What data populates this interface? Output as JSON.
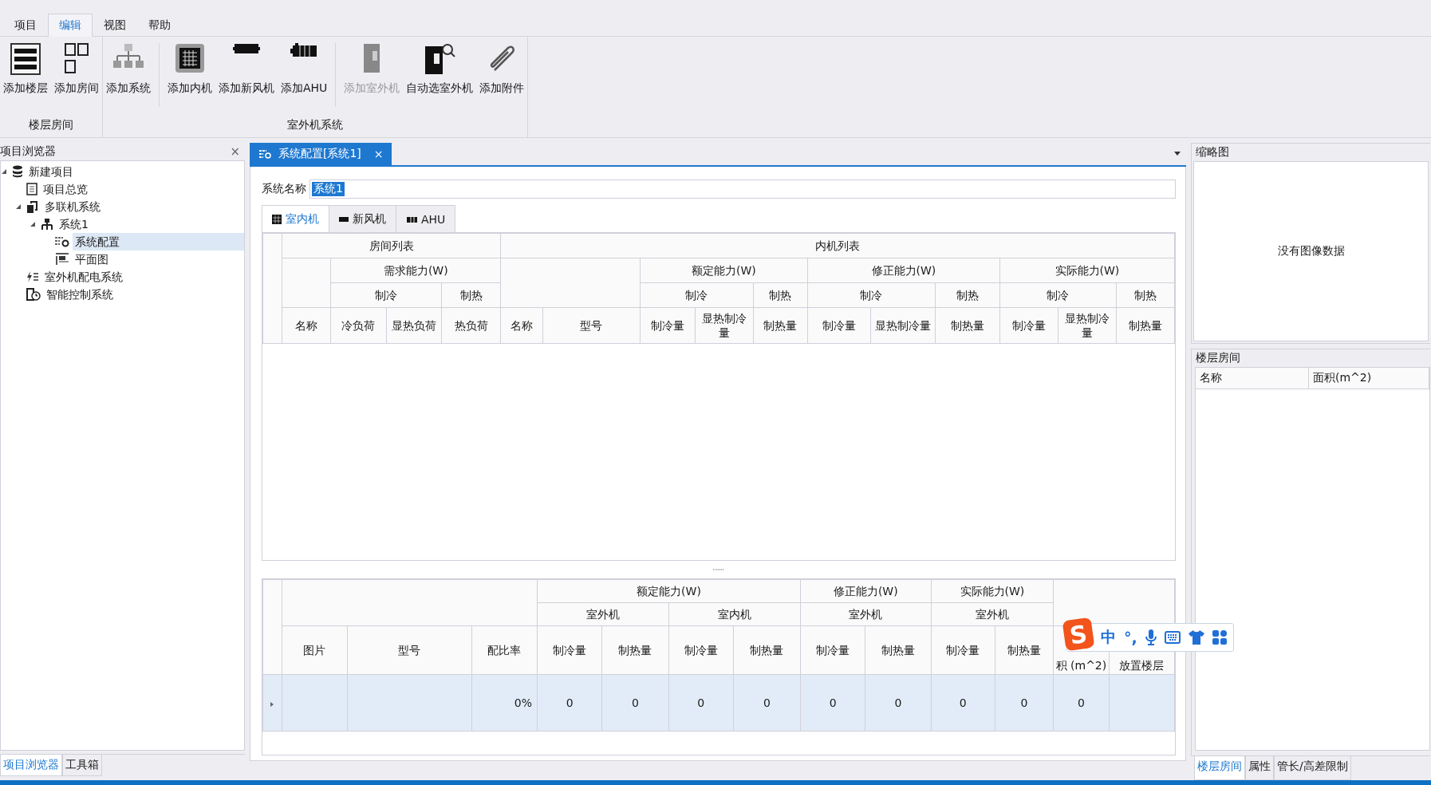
{
  "menu": {
    "tabs": [
      {
        "label": "项目",
        "selected": false
      },
      {
        "label": "编辑",
        "selected": true
      },
      {
        "label": "视图",
        "selected": false
      },
      {
        "label": "帮助",
        "selected": false
      }
    ]
  },
  "ribbon": {
    "groups": [
      {
        "label": "楼层房间",
        "buttons": [
          {
            "label": "添加楼层",
            "disabled": false,
            "divider_before": false
          },
          {
            "label": "添加房间",
            "disabled": false,
            "divider_before": false
          }
        ]
      },
      {
        "label": "室外机系统",
        "buttons": [
          {
            "label": "添加系统",
            "disabled": false,
            "divider_before": false
          },
          {
            "label": "添加内机",
            "disabled": false,
            "divider_before": true
          },
          {
            "label": "添加新风机",
            "disabled": false,
            "divider_before": false
          },
          {
            "label": "添加AHU",
            "disabled": false,
            "divider_before": false
          },
          {
            "label": "添加室外机",
            "disabled": true,
            "divider_before": true
          },
          {
            "label": "自动选室外机",
            "disabled": false,
            "divider_before": false
          },
          {
            "label": "添加附件",
            "disabled": false,
            "divider_before": false
          }
        ]
      }
    ]
  },
  "project_browser": {
    "title": "项目浏览器",
    "close": "×",
    "tree": [
      {
        "label": "新建项目",
        "expanded": true,
        "selected": false,
        "children": [
          {
            "label": "项目总览",
            "selected": false
          },
          {
            "label": "多联机系统",
            "expanded": true,
            "selected": false,
            "children": [
              {
                "label": "系统1",
                "expanded": true,
                "selected": false,
                "children": [
                  {
                    "label": "系统配置",
                    "selected": true
                  },
                  {
                    "label": "平面图",
                    "selected": false
                  }
                ]
              }
            ]
          },
          {
            "label": "室外机配电系统",
            "selected": false
          },
          {
            "label": "智能控制系统",
            "selected": false
          }
        ]
      }
    ],
    "bottom_tabs": [
      {
        "label": "项目浏览器",
        "selected": true
      },
      {
        "label": "工具箱",
        "selected": false
      }
    ]
  },
  "document": {
    "tab": {
      "label": "系统配置[系统1]",
      "close": "×"
    },
    "system_name": {
      "label": "系统名称",
      "value": "系统1",
      "highlighted": true
    },
    "sub_tabs": [
      {
        "label": "室内机",
        "selected": true
      },
      {
        "label": "新风机",
        "selected": false
      },
      {
        "label": "AHU",
        "selected": false
      }
    ],
    "indoor_table": {
      "columns": [
        {
          "label": "房间列表",
          "children": [
            {
              "label": "名称"
            },
            {
              "label": "需求能力(W)",
              "children": [
                {
                  "label": "制冷",
                  "children": [
                    {
                      "label": "冷负荷"
                    },
                    {
                      "label": "显热负荷"
                    }
                  ]
                },
                {
                  "label": "制热",
                  "children": [
                    {
                      "label": "热负荷"
                    }
                  ]
                }
              ]
            }
          ]
        },
        {
          "label": "内机列表",
          "children": [
            {
              "label": "名称"
            },
            {
              "label": "型号"
            },
            {
              "label": "额定能力(W)",
              "children": [
                {
                  "label": "制冷",
                  "children": [
                    {
                      "label": "制冷量"
                    },
                    {
                      "label": "显热制冷量"
                    }
                  ]
                },
                {
                  "label": "制热",
                  "children": [
                    {
                      "label": "制热量"
                    }
                  ]
                }
              ]
            },
            {
              "label": "修正能力(W)",
              "children": [
                {
                  "label": "制冷",
                  "children": [
                    {
                      "label": "制冷量"
                    },
                    {
                      "label": "显热制冷量"
                    }
                  ]
                },
                {
                  "label": "制热",
                  "children": [
                    {
                      "label": "制热量"
                    }
                  ]
                }
              ]
            },
            {
              "label": "实际能力(W)",
              "children": [
                {
                  "label": "制冷",
                  "children": [
                    {
                      "label": "制冷量"
                    },
                    {
                      "label": "显热制冷量"
                    }
                  ]
                },
                {
                  "label": "制热",
                  "children": [
                    {
                      "label": "制热量"
                    }
                  ]
                }
              ]
            }
          ]
        }
      ]
    },
    "outdoor_table": {
      "columns": [
        {
          "label": "图片"
        },
        {
          "label": "型号"
        },
        {
          "label": "配比率"
        },
        {
          "label": "额定能力(W)",
          "colspan": 4,
          "children": [
            {
              "label": "室外机",
              "colspan": 2,
              "children": [
                {
                  "label": "制冷量"
                },
                {
                  "label": "制热量"
                }
              ]
            },
            {
              "label": "室内机",
              "colspan": 2,
              "children": [
                {
                  "label": "制冷量"
                },
                {
                  "label": "制热量"
                }
              ]
            }
          ]
        },
        {
          "label": "修正能力(W)",
          "colspan": 2,
          "children": [
            {
              "label": "室外机",
              "colspan": 2,
              "children": [
                {
                  "label": "制冷量"
                },
                {
                  "label": "制热量"
                }
              ]
            }
          ]
        },
        {
          "label": "实际能力(W)",
          "colspan": 2,
          "children": [
            {
              "label": "室外机",
              "colspan": 2,
              "children": [
                {
                  "label": "制冷量"
                },
                {
                  "label": "制热量"
                }
              ]
            }
          ]
        },
        {
          "label": "积 (m^2)"
        },
        {
          "label": "放置楼层"
        }
      ],
      "rows": [
        {
          "selected": true,
          "cells": [
            "",
            "",
            "0%",
            "0",
            "0",
            "0",
            "0",
            "0",
            "0",
            "0",
            "0",
            "0",
            ""
          ]
        }
      ]
    }
  },
  "thumbnail": {
    "title": "缩略图",
    "empty_text": "没有图像数据"
  },
  "floor_rooms": {
    "title": "楼层房间",
    "columns": [
      "名称",
      "面积(m^2)"
    ]
  },
  "right_tabs": [
    {
      "label": "楼层房间",
      "selected": true
    },
    {
      "label": "属性",
      "selected": false
    },
    {
      "label": "管长/高差限制",
      "selected": false
    }
  ],
  "ime_toolbar": {
    "logo": "S",
    "mode": "中",
    "punctuation": "°,"
  }
}
